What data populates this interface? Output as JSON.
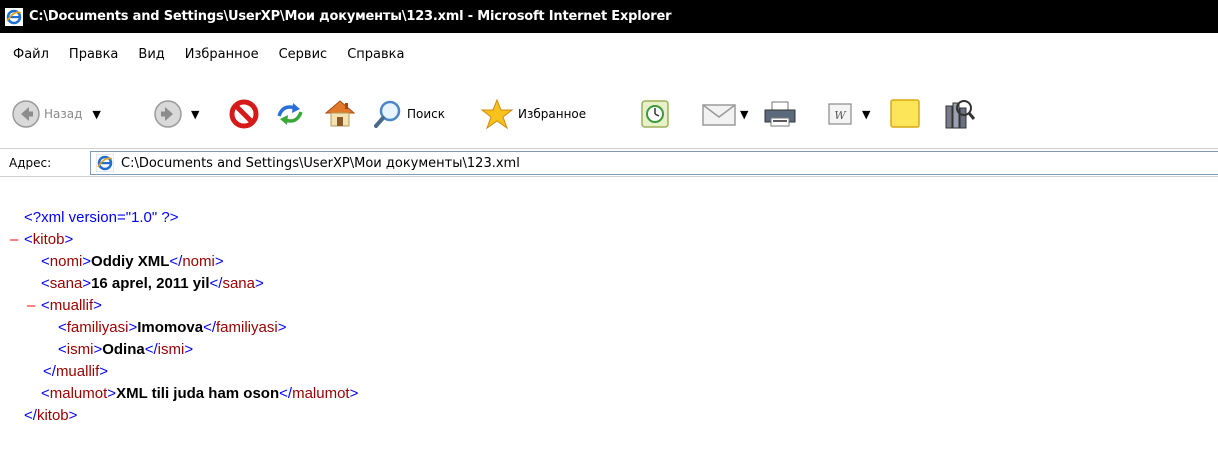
{
  "window": {
    "title": "C:\\Documents and Settings\\UserXP\\Мои документы\\123.xml - Microsoft Internet Explorer"
  },
  "menu": [
    "Файл",
    "Правка",
    "Вид",
    "Избранное",
    "Сервис",
    "Справка"
  ],
  "toolbar": {
    "back_label": "Назад",
    "search_label": "Поиск",
    "favorites_label": "Избранное"
  },
  "address": {
    "label": "Адрес:",
    "value": "C:\\Documents and Settings\\UserXP\\Мои документы\\123.xml"
  },
  "xml": {
    "declaration": "<?xml version=\"1.0\" ?>",
    "collapse_marker": "–",
    "root_tag": "kitob",
    "nomi": {
      "tag": "nomi",
      "text": "Oddiy XML"
    },
    "sana": {
      "tag": "sana",
      "text": "16 aprel, 2011 yil"
    },
    "muallif_tag": "muallif",
    "familiyasi": {
      "tag": "familiyasi",
      "text": "Imomova"
    },
    "ismi": {
      "tag": "ismi",
      "text": "Odina"
    },
    "malumot": {
      "tag": "malumot",
      "text": "XML tili juda ham oson"
    }
  },
  "colors": {
    "markup": "#0000ff",
    "tag_name": "#990000",
    "collapse": "#ff0000",
    "title_bar": "#000000"
  },
  "icons": [
    "ie-logo-icon",
    "back-arrow-icon",
    "forward-arrow-icon",
    "stop-icon",
    "refresh-icon",
    "home-icon",
    "search-magnifier-icon",
    "favorites-star-icon",
    "history-icon",
    "mail-icon",
    "print-icon",
    "edit-word-icon",
    "notes-icon",
    "research-icon"
  ]
}
